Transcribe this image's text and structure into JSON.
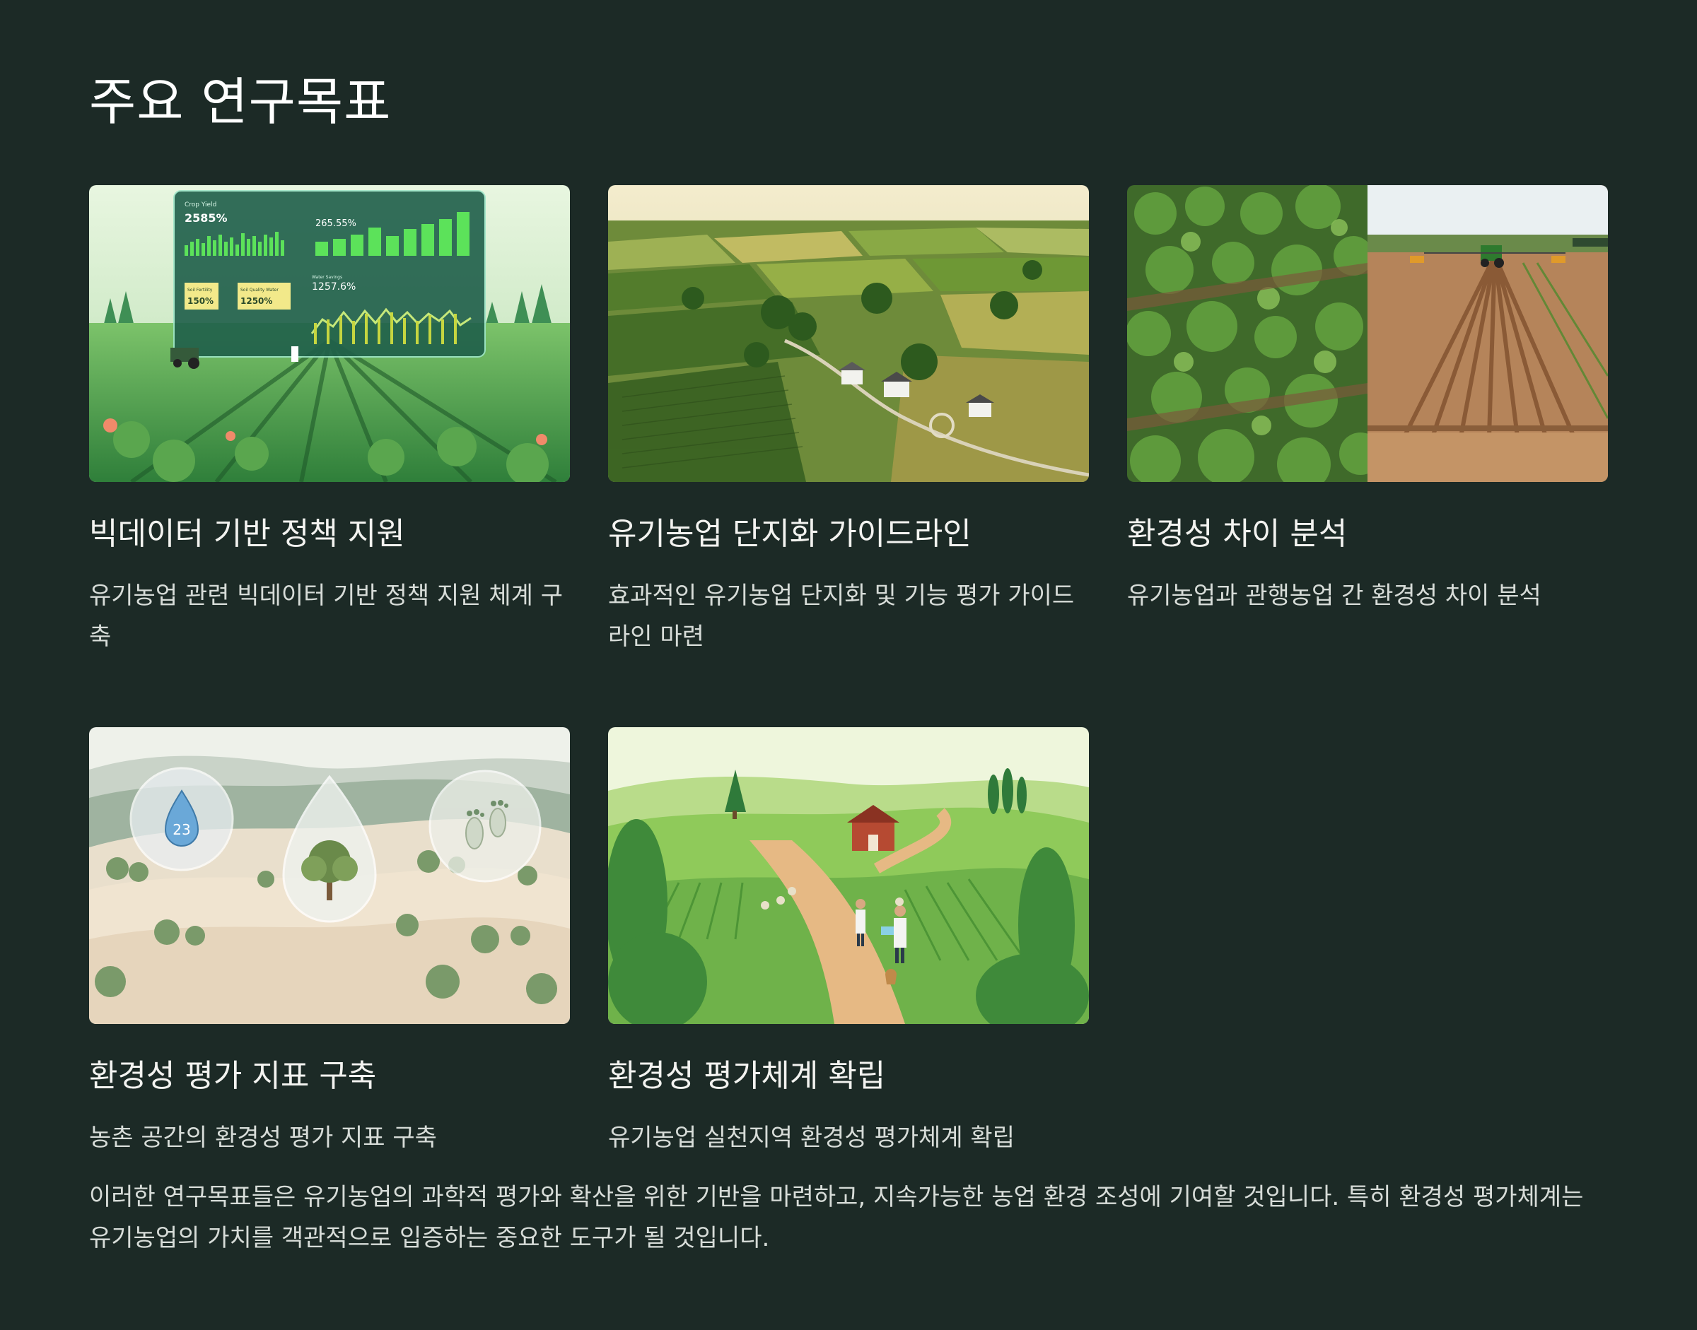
{
  "page": {
    "title": "주요 연구목표",
    "background_color": "#1c2a26"
  },
  "cards": [
    {
      "title": "빅데이터 기반 정책 지원",
      "description": "유기농업 관련 빅데이터 기반 정책 지원 체계 구축",
      "image": {
        "subject": "farm-data-dashboard-illustration",
        "labels": {
          "crop_yield": "Crop Yield",
          "crop_yield_value": "2585%",
          "top_right": "265.55%",
          "soil_fertility": "Soil Fertility",
          "soil_fertility_value": "150%",
          "soil_quality_water": "Soil Quality Water",
          "soil_quality_water_value": "1250%",
          "water_savings": "Water Savings",
          "water_savings_value": "1257.6%"
        }
      }
    },
    {
      "title": "유기농업 단지화 가이드라인",
      "description": "효과적인 유기농업 단지화 및 기능 평가 가이드라인 마련",
      "image": {
        "subject": "aerial-farmland-photo"
      }
    },
    {
      "title": "환경성 차이 분석",
      "description": "유기농업과 관행농업 간 환경성 차이 분석",
      "image": {
        "subject": "organic-vs-conventional-field-split-photo"
      }
    },
    {
      "title": "환경성 평가 지표 구축",
      "description": "농촌 공간의 환경성 평가 지표 구축",
      "image": {
        "subject": "rolling-hills-with-water-tree-footprint-icons",
        "water_drop_number": "23"
      }
    },
    {
      "title": "환경성 평가체계 확립",
      "description": "유기농업 실천지역 환경성 평가체계 확립",
      "image": {
        "subject": "farm-researchers-illustration"
      }
    }
  ],
  "summary": "이러한 연구목표들은 유기농업의 과학적 평가와 확산을 위한 기반을 마련하고, 지속가능한 농업 환경 조성에 기여할 것입니다. 특히 환경성 평가체계는 유기농업의 가치를 객관적으로 입증하는 중요한 도구가 될 것입니다."
}
